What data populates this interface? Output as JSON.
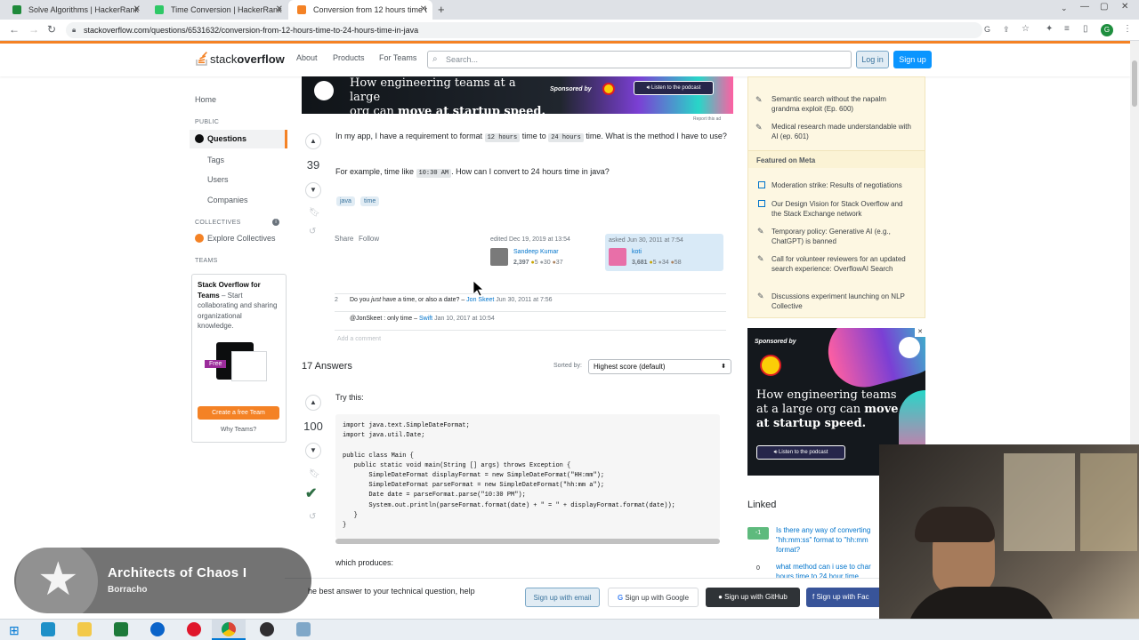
{
  "browser": {
    "tabs": [
      {
        "title": "Solve Algorithms | HackerRank",
        "icon": "hackerrank-icon"
      },
      {
        "title": "Time Conversion | HackerRank",
        "icon": "hackerrank-icon"
      },
      {
        "title": "Conversion from 12 hours time t",
        "icon": "stackoverflow-icon"
      }
    ],
    "url": "stackoverflow.com/questions/6531632/conversion-from-12-hours-time-to-24-hours-time-in-java",
    "profile_initial": "G"
  },
  "so_header": {
    "logo_text_1": "stack",
    "logo_text_2": "overflow",
    "nav": [
      "About",
      "Products",
      "For Teams"
    ],
    "search_placeholder": "Search...",
    "login": "Log in",
    "signup": "Sign up"
  },
  "left_nav": {
    "home": "Home",
    "public": "PUBLIC",
    "questions": "Questions",
    "tags": "Tags",
    "users": "Users",
    "companies": "Companies",
    "collectives": "COLLECTIVES",
    "explore_collectives": "Explore Collectives",
    "teams": "TEAMS",
    "teams_title": "Stack Overflow for Teams",
    "teams_desc": " – Start collaborating and sharing organizational knowledge.",
    "free_badge": "Free",
    "create_team": "Create a free Team",
    "why_teams": "Why Teams?"
  },
  "ad_top": {
    "headline_1": "How engineering teams at a large",
    "headline_2": "org can ",
    "headline_bold": "move at startup speed.",
    "sponsored": "Sponsored by",
    "listen": "Listen to the podcast",
    "report": "Report this ad"
  },
  "question": {
    "votes": "39",
    "p1_a": "In my app, I have a requirement to format ",
    "p1_code1": "12 hours",
    "p1_b": " time to ",
    "p1_code2": "24 hours",
    "p1_c": " time. What is the method I have to use?",
    "p2_a": "For example, time like ",
    "p2_code": "10:30 AM",
    "p2_b": ". How can I convert to 24 hours time in java?",
    "tags": [
      "java",
      "time"
    ],
    "share": "Share",
    "follow": "Follow",
    "edited": "edited Dec 19, 2019 at 13:54",
    "editor": "Sandeep Kumar",
    "editor_rep": "2,397",
    "editor_badges": [
      "5",
      "30",
      "37"
    ],
    "asked": "asked Jun 30, 2011 at 7:54",
    "asker": "koti",
    "asker_rep": "3,681",
    "asker_badges": [
      "5",
      "34",
      "58"
    ]
  },
  "comments": [
    {
      "score": "2",
      "pre": "Do you ",
      "em": "just",
      "post": " have a time, or also a date?",
      "user": "Jon Skeet",
      "date": "Jun 30, 2011 at 7:56"
    },
    {
      "score": "",
      "pre": "@JonSkeet : only time",
      "em": "",
      "post": "",
      "user": "Swift",
      "date": "Jan 10, 2017 at 10:54"
    }
  ],
  "add_comment": "Add a comment",
  "answers": {
    "count_label": "17 Answers",
    "sorted_by": "Sorted by:",
    "sort_value": "Highest score (default)",
    "first": {
      "votes": "100",
      "intro": "Try this:",
      "code": "import java.text.SimpleDateFormat;\nimport java.util.Date;\n\npublic class Main {\n   public static void main(String [] args) throws Exception {\n       SimpleDateFormat displayFormat = new SimpleDateFormat(\"HH:mm\");\n       SimpleDateFormat parseFormat = new SimpleDateFormat(\"hh:mm a\");\n       Date date = parseFormat.parse(\"10:30 PM\");\n       System.out.println(parseFormat.format(date) + \" = \" + displayFormat.format(date));\n   }\n}",
      "produces": "which produces:"
    }
  },
  "right_sidebar": {
    "blog_items": [
      "Semantic search without the napalm grandma exploit (Ep. 600)",
      "Medical research made understandable with AI (ep. 601)"
    ],
    "featured_meta": "Featured on Meta",
    "meta_items": [
      "Moderation strike: Results of negotiations",
      "Our Design Vision for Stack Overflow and the Stack Exchange network",
      "Temporary policy: Generative AI (e.g., ChatGPT) is banned",
      "Call for volunteer reviewers for an updated search experience: OverflowAI Search",
      "Discussions experiment launching on NLP Collective"
    ],
    "ad": {
      "sponsored": "Sponsored by",
      "headline_1": "How engineering teams",
      "headline_2": "at a large org can ",
      "headline_bold_1": "move",
      "headline_bold_2": "at startup speed.",
      "listen": "Listen to the podcast"
    },
    "linked": "Linked",
    "linked_items": [
      {
        "score": "-1",
        "text": "Is there any way of converting \"hh:mm:ss\" format to \"hh:mm format?"
      },
      {
        "score": "0",
        "text": "what method can i use to char hours time to 24 hour time"
      }
    ]
  },
  "signup_bar": {
    "text": "he best answer to your technical question, help",
    "email": "Sign up with email",
    "google": "Sign up with Google",
    "github": "Sign up with GitHub",
    "facebook": "Sign up with Fac"
  },
  "now_playing": {
    "title": "Architects of Chaos I",
    "artist": "Borracho"
  },
  "colors": {
    "so_orange": "#f48225",
    "so_blue": "#0a95ff",
    "accepted_green": "#2f6f44"
  }
}
